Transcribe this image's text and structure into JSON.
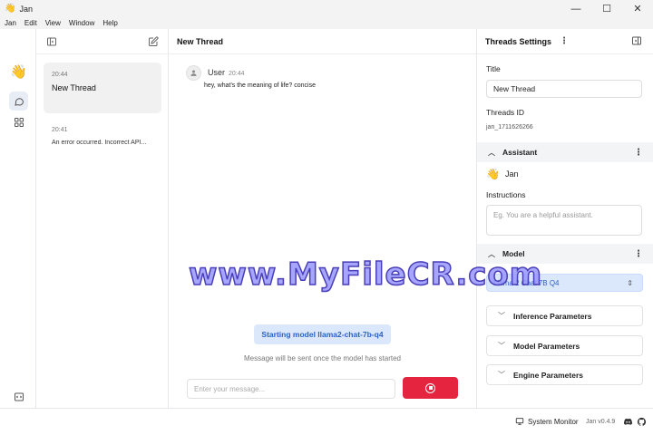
{
  "window": {
    "title": "Jan",
    "app_icon": "👋"
  },
  "menu": [
    "Jan",
    "Edit",
    "View",
    "Window",
    "Help"
  ],
  "rail": {
    "logo": "👋"
  },
  "threads": [
    {
      "time": "20:44",
      "name": "New Thread",
      "preview": ""
    },
    {
      "time": "20:41",
      "name": "",
      "preview": "An error occurred. Incorrect API..."
    }
  ],
  "main": {
    "header": "New Thread",
    "message": {
      "author": "User",
      "time": "20:44",
      "text": "hey, what's the meaning of life? concise"
    },
    "toast": "Starting model llama2-chat-7b-q4",
    "hint": "Message will be sent once the model has started",
    "input_placeholder": "Enter your message..."
  },
  "settings": {
    "header": "Threads Settings",
    "title_label": "Title",
    "title_value": "New Thread",
    "thread_id_label": "Threads ID",
    "thread_id_value": "jan_1711626266",
    "assistant_section": "Assistant",
    "assistant_name": "Jan",
    "assistant_emoji": "👋",
    "instructions_label": "Instructions",
    "instructions_placeholder": "Eg. You are a helpful assistant.",
    "model_section": "Model",
    "model_value": "Llama 2 Chat 7B Q4",
    "accordions": [
      "Inference Parameters",
      "Model Parameters",
      "Engine Parameters"
    ]
  },
  "status": {
    "system_monitor": "System Monitor",
    "version": "Jan v0.4.9"
  },
  "watermark": "www.MyFileCR.com"
}
